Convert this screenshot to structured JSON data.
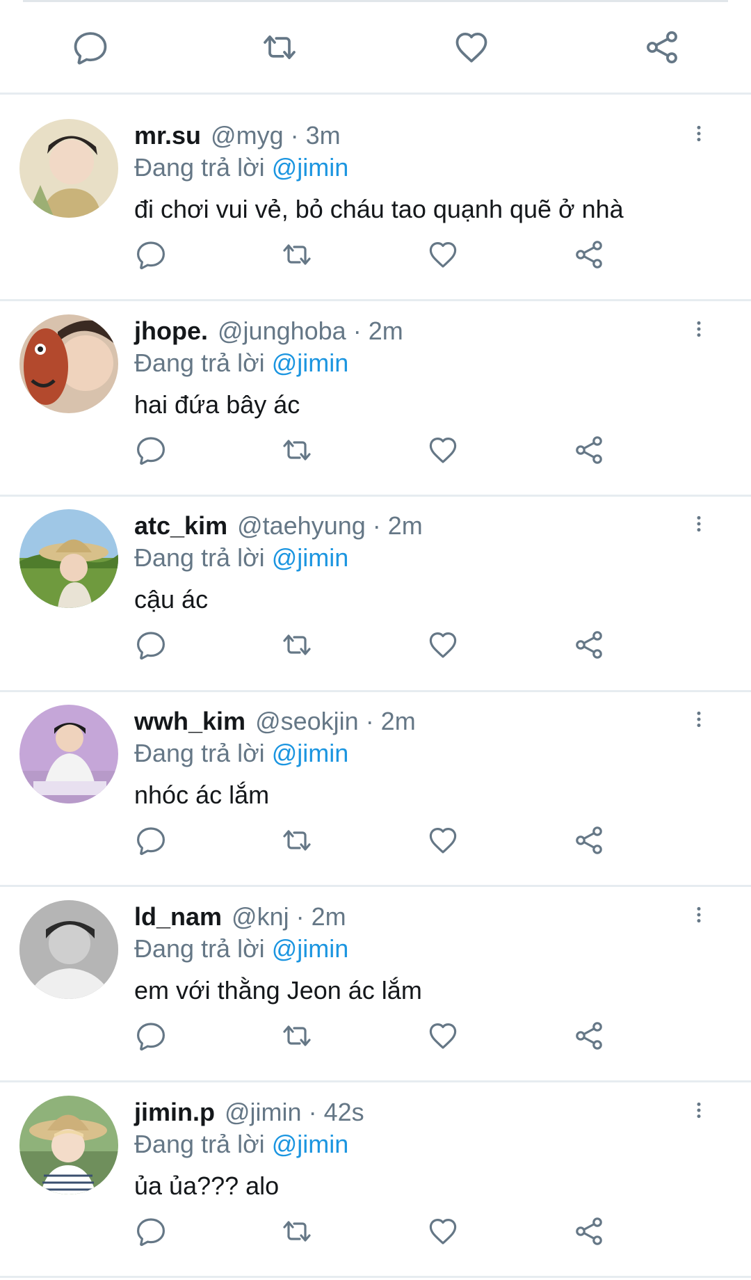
{
  "replying_prefix": "Đang trả lời",
  "colors": {
    "icon": "#657786",
    "mention": "#1b95e0",
    "divider": "#e6ecf0"
  },
  "top_actions": [
    "reply-icon",
    "retweet-icon",
    "like-icon",
    "share-icon"
  ],
  "replies": [
    {
      "name": "mr.su",
      "handle": "@myg",
      "time": "· 3m",
      "mention": "@jimin",
      "text": "đi chơi vui vẻ, bỏ cháu tao quạnh quẽ ở nhà"
    },
    {
      "name": "jhope.",
      "handle": "@junghoba",
      "time": "· 2m",
      "mention": "@jimin",
      "text": "hai đứa bây ác"
    },
    {
      "name": "atc_kim",
      "handle": "@taehyung",
      "time": "· 2m",
      "mention": "@jimin",
      "text": "cậu ác"
    },
    {
      "name": "wwh_kim",
      "handle": "@seokjin",
      "time": "· 2m",
      "mention": "@jimin",
      "text": "nhóc ác lắm"
    },
    {
      "name": "ld_nam",
      "handle": "@knj",
      "time": "· 2m",
      "mention": "@jimin",
      "text": "em với thằng Jeon ác lắm"
    },
    {
      "name": "jimin.p",
      "handle": "@jimin",
      "time": "· 42s",
      "mention": "@jimin",
      "text": "ủa ủa??? alo"
    }
  ]
}
